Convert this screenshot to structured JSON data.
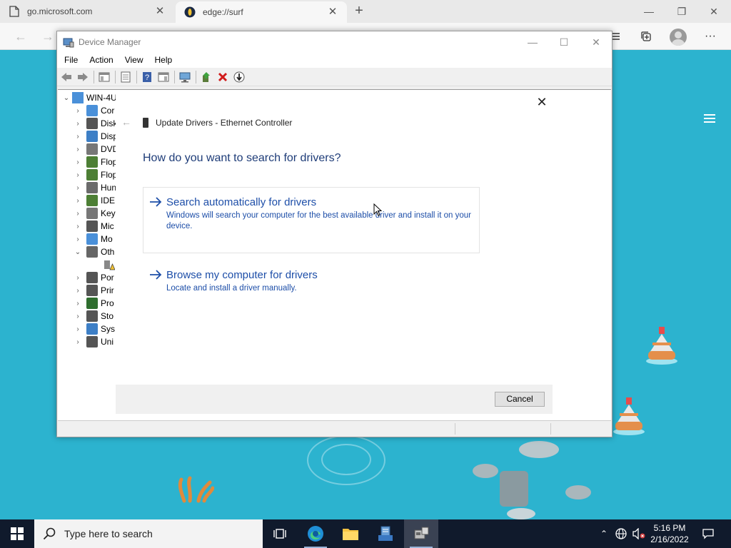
{
  "browser": {
    "tabs": [
      {
        "label": "go.microsoft.com",
        "icon": "page-icon"
      },
      {
        "label": "edge://surf",
        "icon": "surf-icon"
      }
    ],
    "new_tab_symbol": "+",
    "controls": {
      "minimize": "—",
      "restore": "❐",
      "close": "✕"
    }
  },
  "device_manager": {
    "title": "Device Manager",
    "menu": [
      "File",
      "Action",
      "View",
      "Help"
    ],
    "window_controls": {
      "minimize": "—",
      "maximize": "☐",
      "close": "✕"
    },
    "tree": {
      "root": "WIN-4U",
      "items": [
        {
          "label": "Cor",
          "expander": "›"
        },
        {
          "label": "Disk",
          "expander": "›"
        },
        {
          "label": "Disp",
          "expander": "›"
        },
        {
          "label": "DVD",
          "expander": "›"
        },
        {
          "label": "Flop",
          "expander": "›"
        },
        {
          "label": "Flop",
          "expander": "›"
        },
        {
          "label": "Hun",
          "expander": "›"
        },
        {
          "label": "IDE",
          "expander": "›"
        },
        {
          "label": "Key",
          "expander": "›"
        },
        {
          "label": "Mic",
          "expander": "›"
        },
        {
          "label": "Mo",
          "expander": "›"
        },
        {
          "label": "Oth",
          "expander": "⌄"
        },
        {
          "label": "",
          "expander": ""
        },
        {
          "label": "Por",
          "expander": "›"
        },
        {
          "label": "Prir",
          "expander": "›"
        },
        {
          "label": "Pro",
          "expander": "›"
        },
        {
          "label": "Sto",
          "expander": "›"
        },
        {
          "label": "Sys",
          "expander": "›"
        },
        {
          "label": "Uni",
          "expander": "›"
        }
      ]
    }
  },
  "update_drivers": {
    "title": "Update Drivers - Ethernet Controller",
    "question": "How do you want to search for drivers?",
    "options": [
      {
        "title": "Search automatically for drivers",
        "description": "Windows will search your computer for the best available driver and install it on your device."
      },
      {
        "title": "Browse my computer for drivers",
        "description": "Locate and install a driver manually."
      }
    ],
    "cancel_label": "Cancel",
    "close_symbol": "✕",
    "back_symbol": "←"
  },
  "taskbar": {
    "search_placeholder": "Type here to search",
    "time": "5:16 PM",
    "date": "2/16/2022"
  },
  "colors": {
    "ocean": "#2cb3cf",
    "link_blue": "#1d4ea8",
    "heading_blue": "#1e3c78",
    "taskbar": "#101a2c"
  }
}
